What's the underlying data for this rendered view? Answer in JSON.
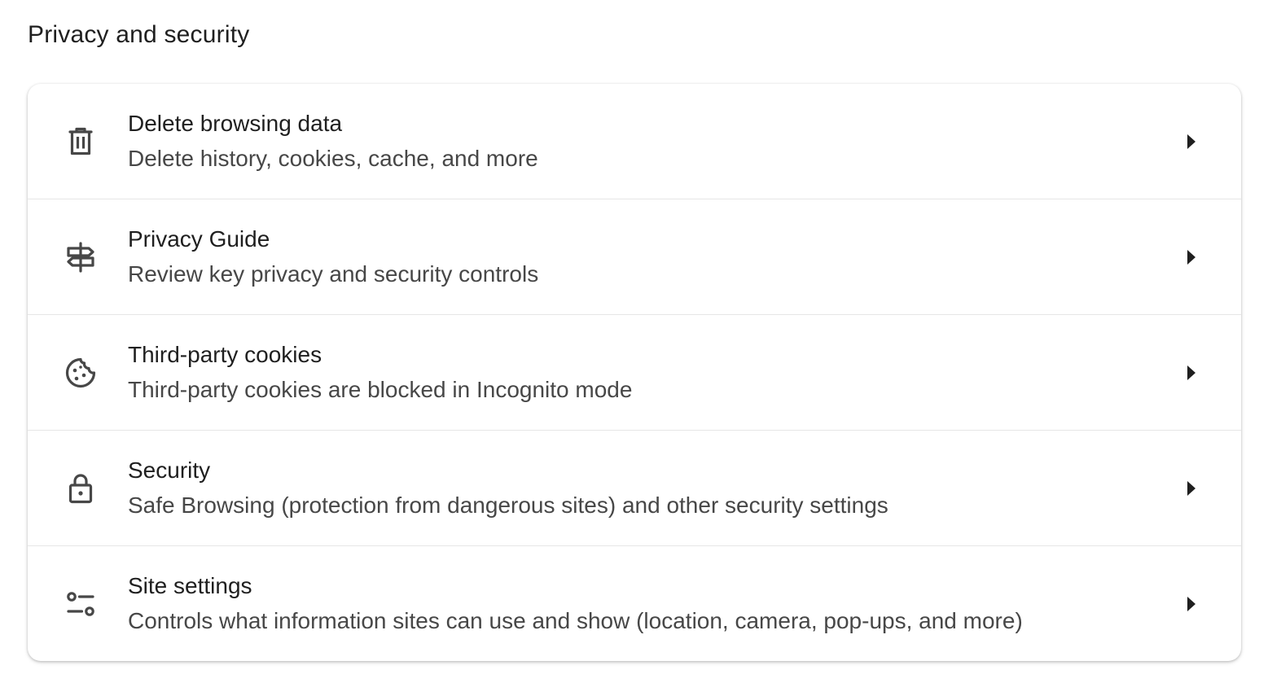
{
  "section": {
    "title": "Privacy and security"
  },
  "items": [
    {
      "icon": "trash-icon",
      "label": "Delete browsing data",
      "sublabel": "Delete history, cookies, cache, and more"
    },
    {
      "icon": "signpost-icon",
      "label": "Privacy Guide",
      "sublabel": "Review key privacy and security controls"
    },
    {
      "icon": "cookie-icon",
      "label": "Third-party cookies",
      "sublabel": "Third-party cookies are blocked in Incognito mode"
    },
    {
      "icon": "lock-icon",
      "label": "Security",
      "sublabel": "Safe Browsing (protection from dangerous sites) and other security settings"
    },
    {
      "icon": "tune-icon",
      "label": "Site settings",
      "sublabel": "Controls what information sites can use and show (location, camera, pop-ups, and more)"
    }
  ],
  "colors": {
    "text_primary": "#1f1f1f",
    "text_secondary": "#474747",
    "icon": "#474747",
    "divider": "#e6e6e6"
  }
}
